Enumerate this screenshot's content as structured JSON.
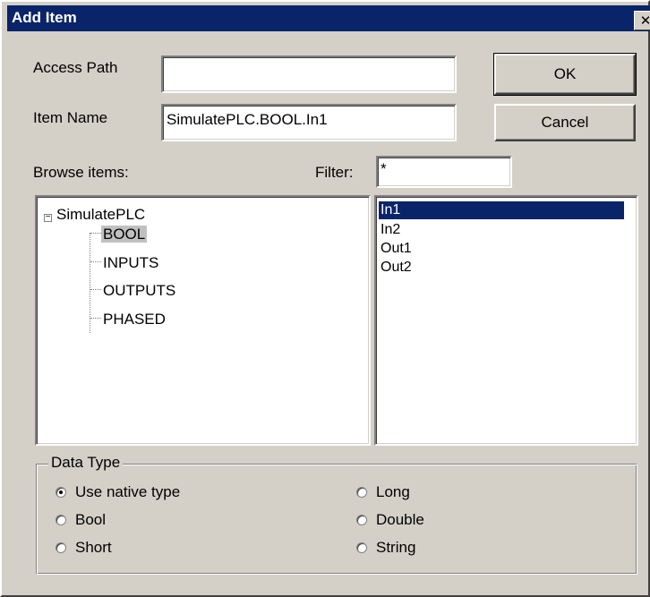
{
  "window": {
    "title": "Add Item",
    "close_glyph": "✕"
  },
  "fields": {
    "access_path": {
      "label": "Access Path",
      "value": ""
    },
    "item_name": {
      "label": "Item Name",
      "value": "SimulatePLC.BOOL.In1"
    }
  },
  "buttons": {
    "ok": "OK",
    "cancel": "Cancel"
  },
  "browse": {
    "label": "Browse items:",
    "filter_label": "Filter:",
    "filter_value": "*",
    "tree": {
      "root": "SimulatePLC",
      "expander": "−",
      "children": [
        "BOOL",
        "INPUTS",
        "OUTPUTS",
        "PHASED"
      ],
      "selected": "BOOL"
    },
    "items": [
      "In1",
      "In2",
      "Out1",
      "Out2"
    ],
    "selected_item": "In1"
  },
  "data_type": {
    "legend": "Data Type",
    "options": [
      "Use native type",
      "Bool",
      "Short",
      "Long",
      "Double",
      "String"
    ],
    "selected": "Use native type"
  },
  "colors": {
    "titlebar": "#0a246a",
    "dialog_bg": "#d4d0c8",
    "selection": "#0a246a"
  },
  "icons": {
    "close": "close-icon",
    "radio": "radio-icon",
    "expander": "minus-box-icon"
  }
}
